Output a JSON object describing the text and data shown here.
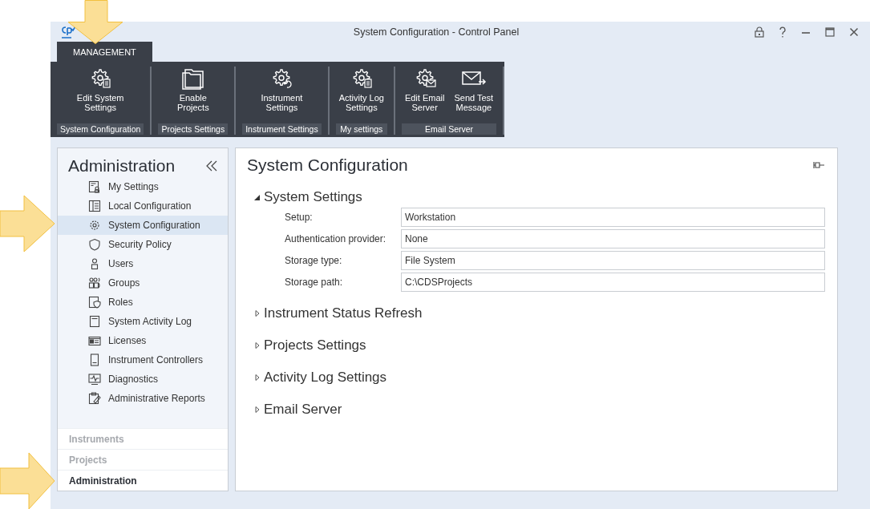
{
  "window": {
    "title": "System Configuration - Control Panel"
  },
  "tabs": [
    {
      "label": "MANAGEMENT",
      "selected": true
    }
  ],
  "ribbon_groups": [
    {
      "label": "System Configuration",
      "buttons": [
        {
          "label": "Edit System\nSettings"
        }
      ]
    },
    {
      "label": "Projects Settings",
      "buttons": [
        {
          "label": "Enable\nProjects"
        }
      ]
    },
    {
      "label": "Instrument Settings",
      "buttons": [
        {
          "label": "Instrument\nSettings"
        }
      ]
    },
    {
      "label": "My settings",
      "buttons": [
        {
          "label": "Activity Log\nSettings"
        }
      ]
    },
    {
      "label": "Email Server",
      "buttons": [
        {
          "label": "Edit Email\nServer"
        },
        {
          "label": "Send Test\nMessage"
        }
      ]
    }
  ],
  "sidebar": {
    "title": "Administration",
    "items": [
      {
        "label": "My Settings",
        "selected": false
      },
      {
        "label": "Local Configuration",
        "selected": false
      },
      {
        "label": "System Configuration",
        "selected": true
      },
      {
        "label": "Security Policy",
        "selected": false
      },
      {
        "label": "Users",
        "selected": false
      },
      {
        "label": "Groups",
        "selected": false
      },
      {
        "label": "Roles",
        "selected": false
      },
      {
        "label": "System Activity Log",
        "selected": false
      },
      {
        "label": "Licenses",
        "selected": false
      },
      {
        "label": "Instrument Controllers",
        "selected": false
      },
      {
        "label": "Diagnostics",
        "selected": false
      },
      {
        "label": "Administrative Reports",
        "selected": false
      }
    ],
    "nav": [
      {
        "label": "Instruments",
        "selected": false
      },
      {
        "label": "Projects",
        "selected": false
      },
      {
        "label": "Administration",
        "selected": true
      }
    ]
  },
  "content": {
    "title": "System Configuration",
    "sections": [
      {
        "title": "System Settings",
        "expanded": true,
        "fields": [
          {
            "label": "Setup:",
            "value": "Workstation"
          },
          {
            "label": "Authentication provider:",
            "value": "None"
          },
          {
            "label": "Storage type:",
            "value": "File System"
          },
          {
            "label": "Storage path:",
            "value": "C:\\CDSProjects"
          }
        ]
      },
      {
        "title": "Instrument Status Refresh",
        "expanded": false
      },
      {
        "title": "Projects Settings",
        "expanded": false
      },
      {
        "title": "Activity Log Settings",
        "expanded": false
      },
      {
        "title": "Email Server",
        "expanded": false
      }
    ]
  }
}
